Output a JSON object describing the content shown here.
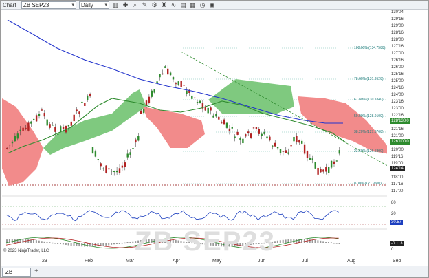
{
  "toolbar": {
    "chart_label": "Chart",
    "instrument": "ZB SEP23",
    "period": "Daily"
  },
  "icons": [
    "chart-menu-icon",
    "instrument-dropdown-icon",
    "period-dropdown-icon",
    "bars-icon",
    "crosshair-icon",
    "zoom-icon",
    "drawing-icon",
    "properties-icon",
    "strategy-icon",
    "indicator-icon",
    "template-icon",
    "data-box-icon",
    "time-frame-icon",
    "screenshot-icon",
    "back-arrow-icon",
    "add-tab-icon"
  ],
  "tab": {
    "label": "ZB"
  },
  "watermark": "ZB SEP23",
  "copyright": "© 2023 NinjaTrader, LLC",
  "x_labels": [
    "23",
    "Feb",
    "Mar",
    "Apr",
    "May",
    "Jun",
    "Jul",
    "Aug",
    "Sep"
  ],
  "y_labels": [
    "130'04",
    "129'16",
    "129'00",
    "128'16",
    "128'00",
    "127'16",
    "127'00",
    "126'16",
    "126'00",
    "125'16",
    "125'00",
    "124'16",
    "124'00",
    "123'16",
    "123'00",
    "122'16",
    "122'00",
    "121'16",
    "121'00",
    "120'16",
    "120'00",
    "119'16",
    "119'00",
    "118'16",
    "118'00",
    "117'16",
    "117'00"
  ],
  "price_tags": {
    "tag1": "128'130'0",
    "tag2": "126'100'0",
    "tag3": "124'14"
  },
  "fib_labels": [
    "100.00% (134.7500)",
    "78.60% (131.9520)",
    "61.80% (130.1840)",
    "50.00% (128.9100)",
    "38.20% (127.6760)",
    "23.60% (126.5800)",
    "0.00% (121.9500)"
  ],
  "rsi_labels": [
    "80",
    "20",
    "30.57"
  ],
  "macd_labels": [
    "-0.113",
    "0"
  ],
  "colors": {
    "bull_candle": "#2e8b2e",
    "bear_candle": "#b22222",
    "kumo_bull": "#7fc97f",
    "kumo_bear": "#f28b8b",
    "ma_blue": "#2233cc",
    "ma_green": "#2e8b2e",
    "trendline": "#2e8b2e",
    "support": "#8b0000"
  }
}
